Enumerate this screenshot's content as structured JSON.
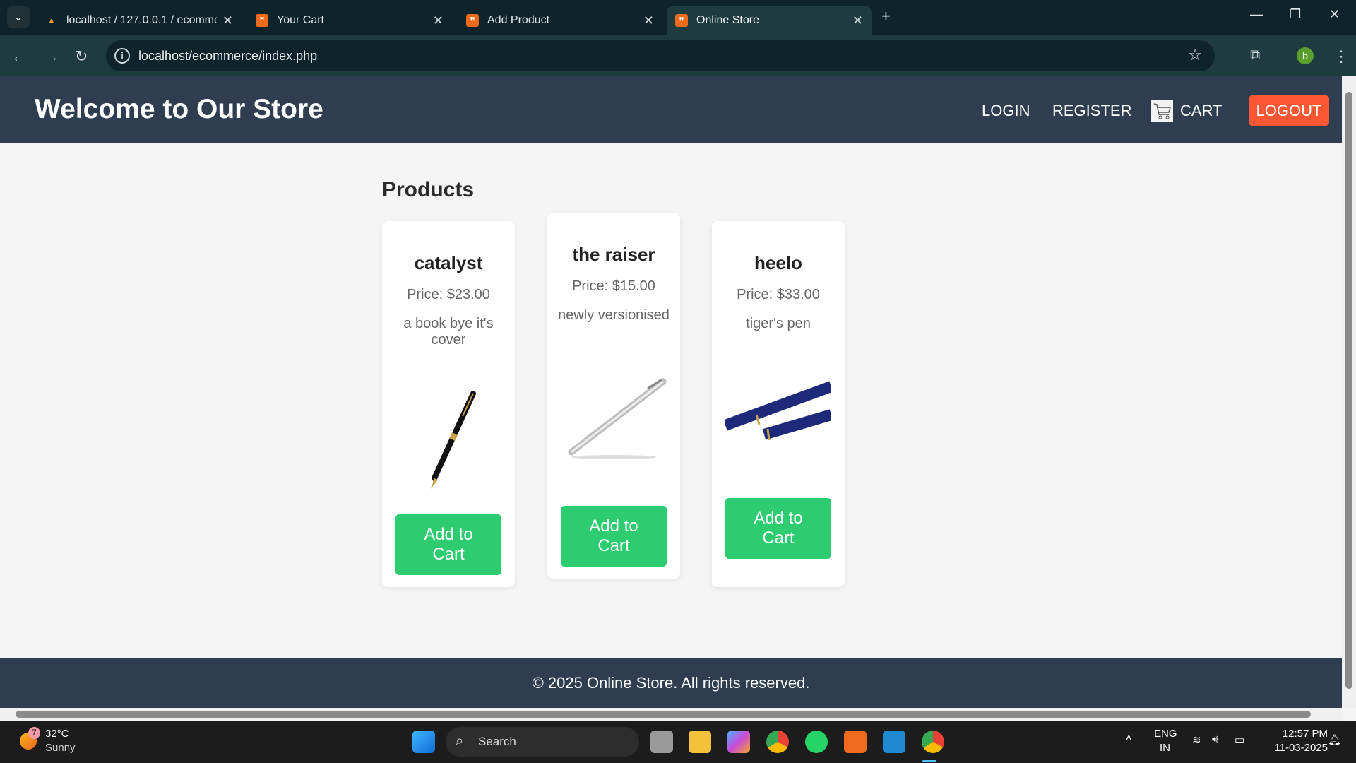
{
  "browser": {
    "tabs": [
      {
        "title": "localhost / 127.0.0.1 / ecommerce",
        "active": false
      },
      {
        "title": "Your Cart",
        "active": false
      },
      {
        "title": "Add Product",
        "active": false
      },
      {
        "title": "Online Store",
        "active": true
      }
    ],
    "url": "localhost/ecommerce/index.php",
    "profile_initial": "b"
  },
  "header": {
    "title": "Welcome to Our Store",
    "nav": {
      "login": "LOGIN",
      "register": "REGISTER",
      "cart": "CART",
      "logout": "LOGOUT"
    }
  },
  "main": {
    "heading": "Products",
    "products": [
      {
        "name": "catalyst",
        "price": "Price: $23.00",
        "description": "a book bye it's cover",
        "button": "Add to Cart"
      },
      {
        "name": "the raiser",
        "price": "Price: $15.00",
        "description": "newly versionised",
        "button": "Add to Cart"
      },
      {
        "name": "heelo",
        "price": "Price: $33.00",
        "description": "tiger's pen",
        "button": "Add to Cart"
      }
    ]
  },
  "footer": {
    "text": "© 2025 Online Store. All rights reserved."
  },
  "taskbar": {
    "weather": {
      "temp": "32°C",
      "condition": "Sunny",
      "badge": "7"
    },
    "search": "Search",
    "lang": "ENG",
    "region": "IN",
    "time": "12:57 PM",
    "date": "11-03-2025"
  },
  "colors": {
    "header": "#2e3e50",
    "logout": "#ff5733",
    "add_to_cart": "#2ecc71"
  }
}
